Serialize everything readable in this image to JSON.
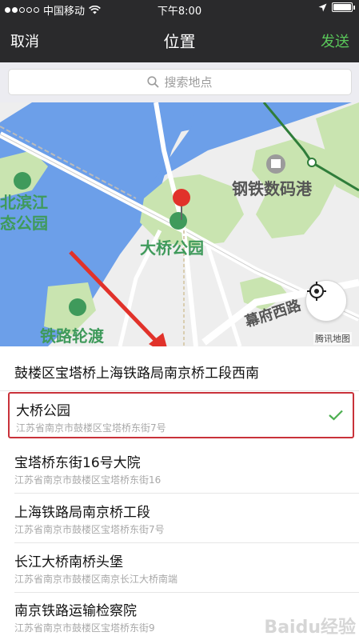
{
  "status_bar": {
    "carrier": "中国移动",
    "time": "下午8:00"
  },
  "nav": {
    "cancel": "取消",
    "title": "位置",
    "send": "发送"
  },
  "search": {
    "placeholder": "搜索地点"
  },
  "map": {
    "labels": {
      "park_left": "北滨江\n态公园",
      "steel": "钢铁数码港",
      "bridge_park": "大桥公园",
      "rail_ferry": "铁路轮渡",
      "road": "幕府西路",
      "logo": "腾讯地图"
    },
    "colors": {
      "water": "#6c9fe9",
      "park": "#c9e4b0",
      "road": "#ffffff",
      "pin": "#e1322a",
      "poi_green": "#3f9a5b",
      "metro": "#2f7d3a"
    }
  },
  "list": {
    "header": "鼓楼区宝塔桥上海铁路局南京桥工段西南",
    "items": [
      {
        "title": "大桥公园",
        "subtitle": "江苏省南京市鼓楼区宝塔桥东街7号",
        "selected": true
      },
      {
        "title": "宝塔桥东街16号大院",
        "subtitle": "江苏省南京市鼓楼区宝塔桥东街16",
        "selected": false
      },
      {
        "title": "上海铁路局南京桥工段",
        "subtitle": "江苏省南京市鼓楼区宝塔桥东街7号",
        "selected": false
      },
      {
        "title": "长江大桥南桥头堡",
        "subtitle": "江苏省南京市鼓楼区南京长江大桥南端",
        "selected": false
      },
      {
        "title": "南京铁路运输检察院",
        "subtitle": "江苏省南京市鼓楼区宝塔桥东街9",
        "selected": false
      }
    ]
  },
  "watermark": "Baidu经验"
}
